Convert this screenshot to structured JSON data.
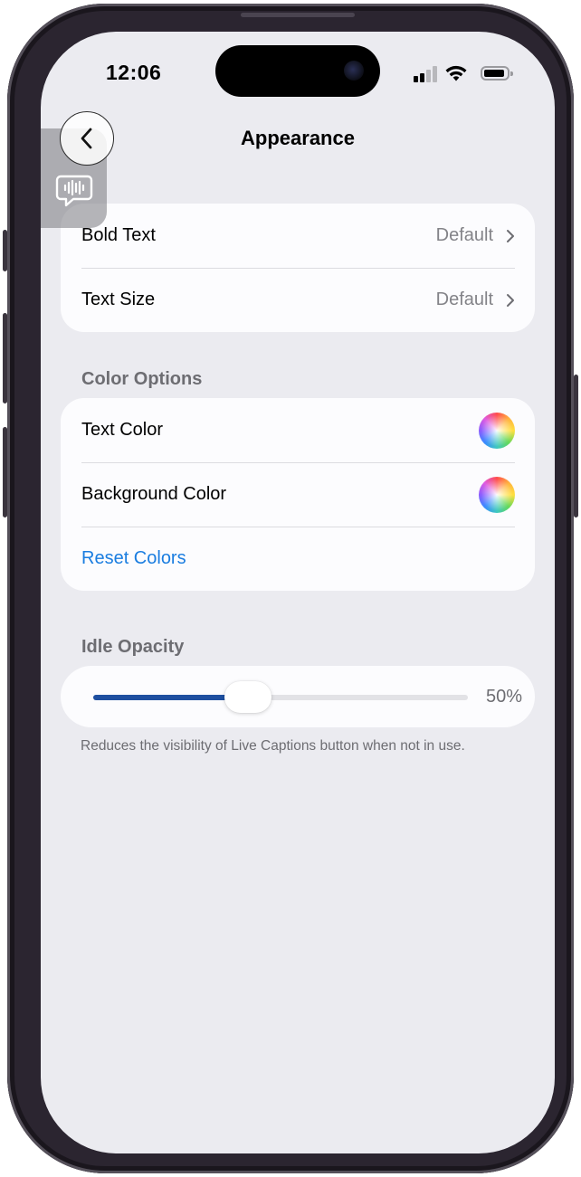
{
  "status_bar": {
    "time": "12:06"
  },
  "nav": {
    "title": "Appearance"
  },
  "text_settings": [
    {
      "label": "Bold Text",
      "value": "Default"
    },
    {
      "label": "Text Size",
      "value": "Default"
    }
  ],
  "color_options": {
    "header": "Color Options",
    "rows": [
      {
        "label": "Text Color"
      },
      {
        "label": "Background Color"
      }
    ],
    "reset_label": "Reset Colors"
  },
  "idle_opacity": {
    "header": "Idle Opacity",
    "value": 50,
    "value_label": "50%",
    "footer": "Reduces the visibility of Live Captions button when not in use."
  },
  "colors": {
    "accent": "#1a7de0",
    "slider_fill": "#1e4fa0",
    "background": "#ebebf0"
  }
}
